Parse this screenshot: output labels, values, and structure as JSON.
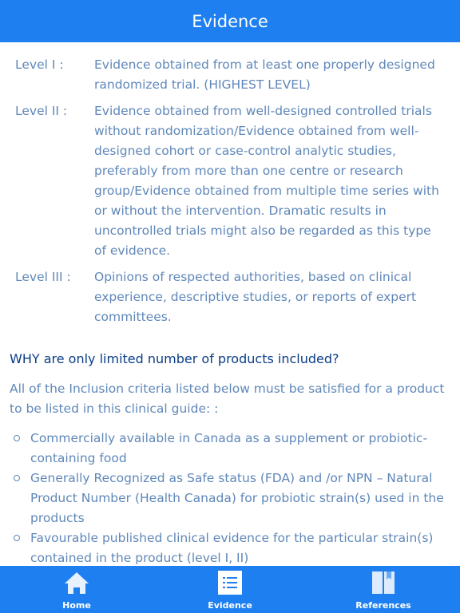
{
  "header": {
    "title": "Evidence"
  },
  "levels": [
    {
      "label": "Level I :",
      "text": "Evidence obtained from at least one properly designed randomized trial. (HIGHEST LEVEL)"
    },
    {
      "label": "Level II :",
      "text": "Evidence obtained from well-designed controlled trials without randomization/Evidence obtained from well-designed cohort or case-control analytic studies, preferably from more than one centre or research group/Evidence obtained from multiple time series with or without the intervention. Dramatic results in uncontrolled trials might also be regarded as this type of evidence."
    },
    {
      "label": "Level III :",
      "text": "Opinions of respected authorities, based on clinical experience, descriptive studies, or reports of expert committees."
    }
  ],
  "section": {
    "question": "WHY are only limited number of products included?",
    "intro": "All of the Inclusion criteria listed below must be satisfied for a product to be listed in this clinical guide: :",
    "criteria": [
      "Commercially available in Canada as a supplement or probiotic-containing food",
      "Generally Recognized as Safe status (FDA) and /or NPN – Natural Product Number (Health Canada) for probiotic strain(s) used in the products",
      "Favourable published clinical evidence for the particular strain(s) contained in the product (level I, II)"
    ]
  },
  "tabs": [
    {
      "label": "Home",
      "icon": "home-icon"
    },
    {
      "label": "Evidence",
      "icon": "list-icon",
      "active": true
    },
    {
      "label": "References",
      "icon": "book-icon"
    }
  ],
  "colors": {
    "primary": "#1d7ff0",
    "body_text": "#5f87b9",
    "heading_text": "#0a3c86"
  }
}
